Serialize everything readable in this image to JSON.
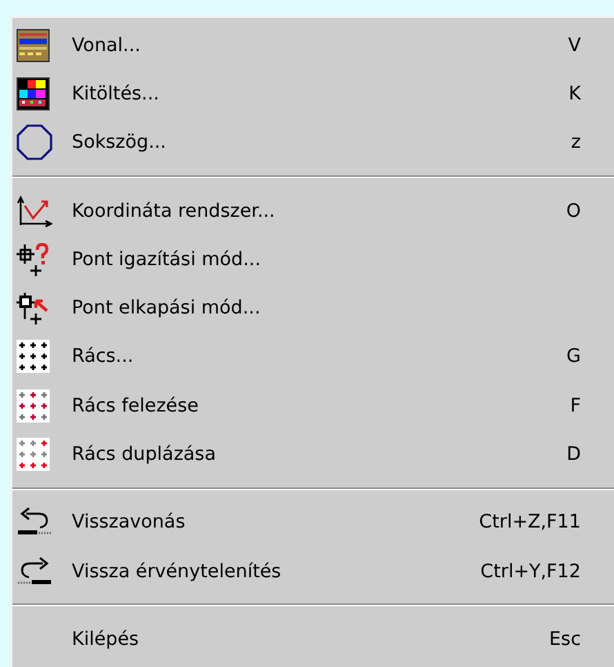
{
  "menu": {
    "groups": [
      {
        "items": [
          {
            "kind": "line-style",
            "label": "Vonal...",
            "shortcut": "V"
          },
          {
            "kind": "fill",
            "label": "Kitöltés...",
            "shortcut": "K"
          },
          {
            "kind": "polygon",
            "label": "Sokszög...",
            "shortcut": "z"
          }
        ]
      },
      {
        "items": [
          {
            "kind": "axes",
            "label": "Koordináta rendszer...",
            "shortcut": "O"
          },
          {
            "kind": "snap-align",
            "label": "Pont igazítási mód..."
          },
          {
            "kind": "snap-catch",
            "label": "Pont elkapási mód..."
          },
          {
            "kind": "grid",
            "label": "Rács...",
            "shortcut": "G"
          },
          {
            "kind": "grid-half",
            "label": "Rács felezése",
            "shortcut": "F"
          },
          {
            "kind": "grid-double",
            "label": "Rács duplázása",
            "shortcut": "D"
          }
        ]
      },
      {
        "items": [
          {
            "kind": "undo",
            "label": "Visszavonás",
            "shortcut": "Ctrl+Z,F11"
          },
          {
            "kind": "redo",
            "label": "Vissza érvénytelenítés",
            "shortcut": "Ctrl+Y,F12"
          }
        ]
      },
      {
        "items": [
          {
            "kind": "none",
            "label": "Kilépés",
            "shortcut": "Esc"
          }
        ]
      }
    ]
  }
}
